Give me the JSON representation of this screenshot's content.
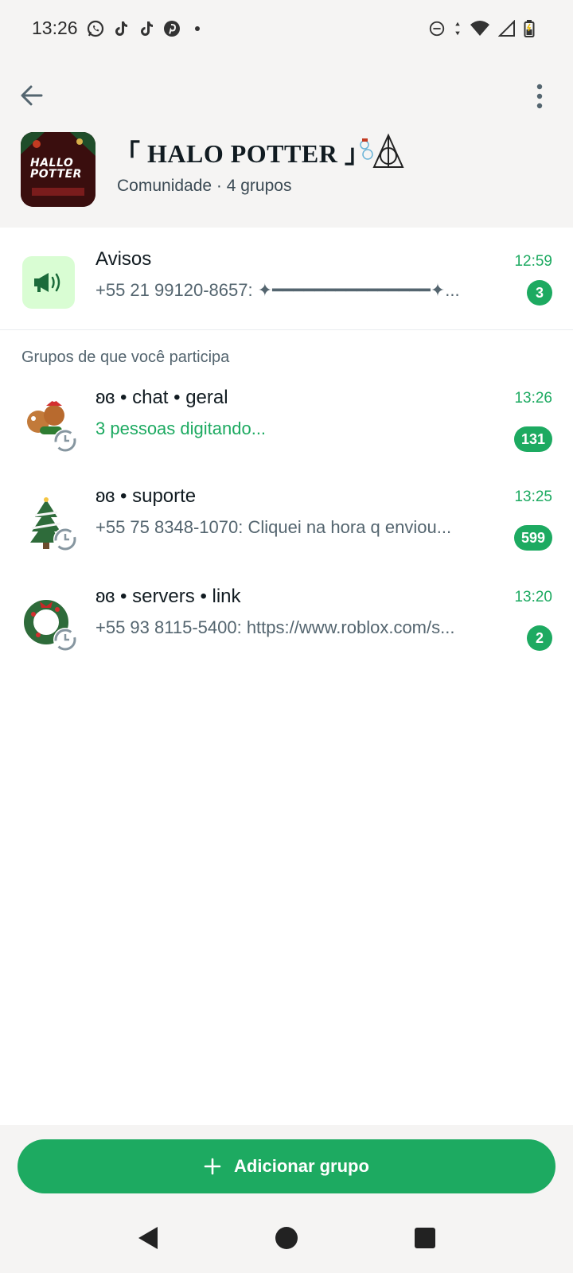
{
  "status_bar": {
    "time": "13:26",
    "app_icons": [
      "whatsapp-icon",
      "tiktok-icon",
      "tiktok-icon",
      "pinterest-icon"
    ],
    "right_icons": [
      "dnd-icon",
      "data-arrows-icon",
      "wifi-icon",
      "signal-icon",
      "battery-icon"
    ]
  },
  "header": {
    "community_name": "「 HALO POTTER 」",
    "subtitle": "Comunidade · 4 grupos",
    "avatar_text_line1": "HALLO",
    "avatar_text_line2": "POTTER"
  },
  "announcement": {
    "title": "Avisos",
    "last_message": "+55 21 99120-8657: ✦━━━━━━━━━━━━━━━✦...",
    "time": "12:59",
    "unread": "3"
  },
  "section_label": "Grupos de que você participa",
  "groups": [
    {
      "title": "ʚɞ • chat • geral",
      "last_message": "3 pessoas digitando...",
      "time": "13:26",
      "unread": "131",
      "typing": true,
      "avatar": "gingerbread-icon"
    },
    {
      "title": "ʚɞ • suporte",
      "last_message": "+55 75 8348-1070: Cliquei na hora q enviou...",
      "time": "13:25",
      "unread": "599",
      "typing": false,
      "avatar": "christmas-tree-icon"
    },
    {
      "title": "ʚɞ • servers • link",
      "last_message": "+55 93 8115-5400: https://www.roblox.com/s...",
      "time": "13:20",
      "unread": "2",
      "typing": false,
      "avatar": "wreath-icon"
    }
  ],
  "add_button": {
    "label": "Adicionar grupo",
    "icon": "plus-icon"
  },
  "colors": {
    "accent": "#1daa61",
    "header_bg": "#f5f4f3",
    "announce_bg": "#d9fdd3"
  }
}
